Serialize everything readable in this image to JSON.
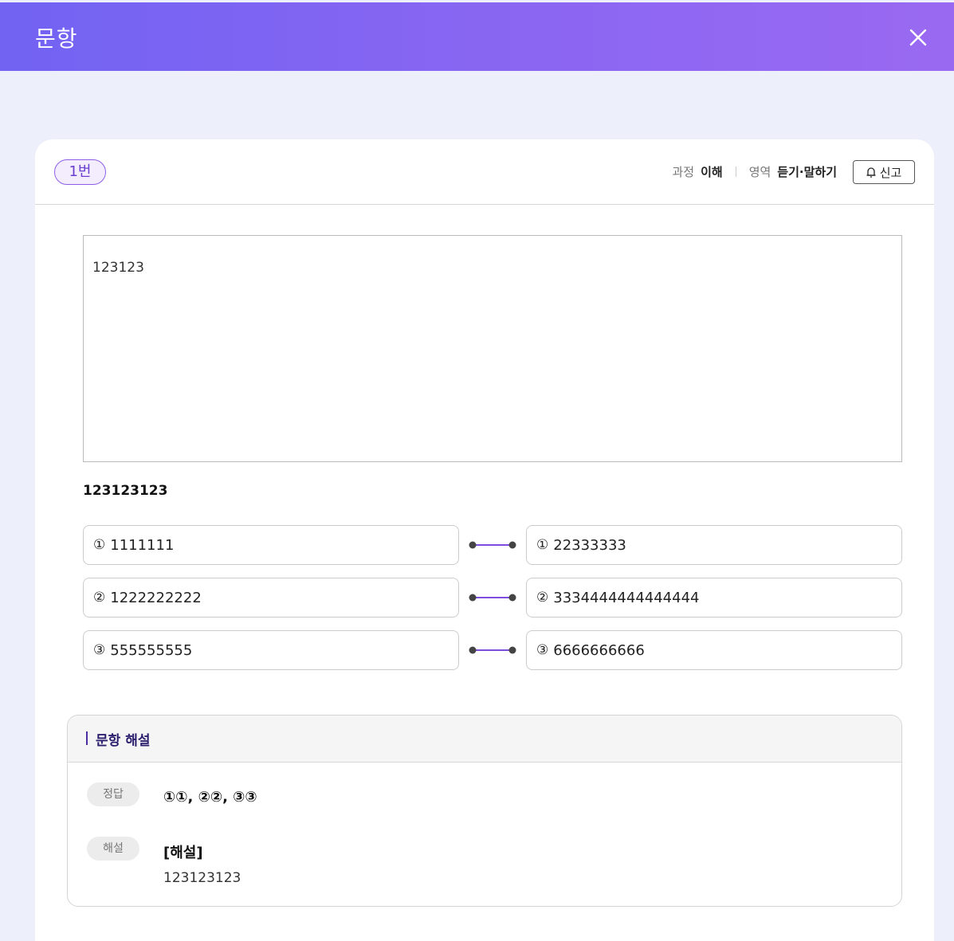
{
  "header": {
    "title": "문항",
    "close_icon": "close-icon"
  },
  "card": {
    "number": "1번",
    "meta": [
      {
        "label": "과정",
        "value": "이해"
      },
      {
        "label": "영역",
        "value": "듣기·말하기"
      }
    ],
    "report_label": "신고"
  },
  "passage": "123123",
  "question": "123123123",
  "matching": {
    "left": [
      {
        "mark": "①",
        "text": "1111111"
      },
      {
        "mark": "②",
        "text": "1222222222"
      },
      {
        "mark": "③",
        "text": "555555555"
      }
    ],
    "right": [
      {
        "mark": "①",
        "text": "22333333"
      },
      {
        "mark": "②",
        "text": "3334444444444444"
      },
      {
        "mark": "③",
        "text": "6666666666"
      }
    ]
  },
  "explanation": {
    "title": "문항 해설",
    "answer_tag": "정답",
    "answer": "①①, ②②, ③③",
    "solution_tag": "해설",
    "solution_title": "[해설]",
    "solution_body": "123123123"
  },
  "colors": {
    "accent": "#8a66f2",
    "connector": "#7b4ee0",
    "dot": "#444444"
  }
}
